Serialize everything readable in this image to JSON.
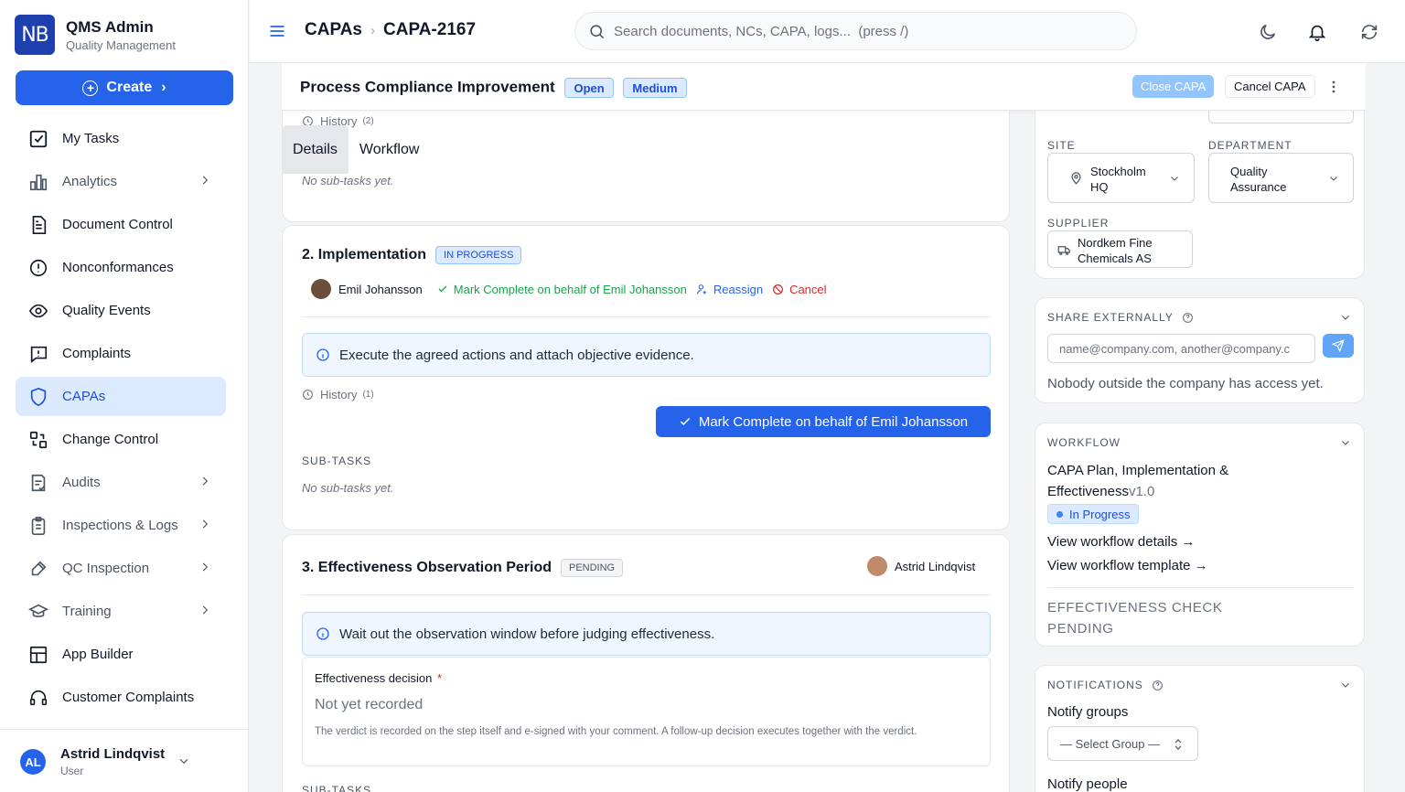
{
  "brand": {
    "logo": "NB",
    "title": "QMS Admin",
    "subtitle": "Quality Management"
  },
  "create_label": "Create",
  "nav": [
    {
      "label": "My Tasks",
      "icon": "checkbox-icon",
      "arrow": false,
      "muted": false
    },
    {
      "label": "Analytics",
      "icon": "analytics-icon",
      "arrow": true,
      "muted": true
    },
    {
      "label": "Document Control",
      "icon": "document-icon",
      "arrow": false,
      "muted": false
    },
    {
      "label": "Nonconformances",
      "icon": "alert-circle-icon",
      "arrow": false,
      "muted": false
    },
    {
      "label": "Quality Events",
      "icon": "eye-icon",
      "arrow": false,
      "muted": false
    },
    {
      "label": "Complaints",
      "icon": "message-alert-icon",
      "arrow": false,
      "muted": false
    },
    {
      "label": "CAPAs",
      "icon": "shield-icon",
      "arrow": false,
      "active": true
    },
    {
      "label": "Change Control",
      "icon": "change-control-icon",
      "arrow": false,
      "muted": false
    },
    {
      "label": "Audits",
      "icon": "audit-icon",
      "arrow": true,
      "muted": true
    },
    {
      "label": "Inspections & Logs",
      "icon": "clipboard-icon",
      "arrow": true,
      "muted": true
    },
    {
      "label": "QC Inspection",
      "icon": "tools-icon",
      "arrow": true,
      "muted": true
    },
    {
      "label": "Training",
      "icon": "graduation-cap-icon",
      "arrow": true,
      "muted": true
    },
    {
      "label": "App Builder",
      "icon": "grid-icon",
      "arrow": false,
      "muted": false
    },
    {
      "label": "Customer Complaints",
      "icon": "headset-icon",
      "arrow": false,
      "muted": false
    }
  ],
  "user": {
    "initials": "AL",
    "name": "Astrid Lindqvist",
    "role": "User"
  },
  "breadcrumb": {
    "parent": "CAPAs",
    "current": "CAPA-2167"
  },
  "search": {
    "placeholder": "Search documents, NCs, CAPA, logs...  (press /)"
  },
  "capa": {
    "title": "Process Compliance Improvement",
    "status": "Open",
    "priority": "Medium",
    "close_label": "Close CAPA",
    "cancel_label": "Cancel CAPA"
  },
  "tabs": [
    "Details",
    "Workflow"
  ],
  "history_top": {
    "label": "History",
    "count": "(2)"
  },
  "step1": {
    "no_subtasks": "No sub-tasks yet."
  },
  "step2": {
    "title": "2. Implementation",
    "status": "IN PROGRESS",
    "assignee": "Emil Johansson",
    "mark_link": "Mark Complete on behalf of Emil Johansson",
    "reassign": "Reassign",
    "cancel": "Cancel",
    "info": "Execute the agreed actions and attach objective evidence.",
    "history": {
      "label": "History",
      "count": "(1)"
    },
    "mark_button": "Mark Complete on behalf of Emil Johansson",
    "subtasks_label": "SUB-TASKS",
    "no_subtasks": "No sub-tasks yet."
  },
  "step3": {
    "title": "3. Effectiveness Observation Period",
    "status": "PENDING",
    "assignee": "Astrid Lindqvist",
    "info": "Wait out the observation window before judging effectiveness.",
    "decision_label": "Effectiveness decision",
    "required_mark": "*",
    "decision_value": "Not yet recorded",
    "decision_help": "The verdict is recorded on the step itself and e-signed with your comment. A follow-up decision executes together with the verdict.",
    "subtasks_label": "SUB-TASKS"
  },
  "details": {
    "site_label": "SITE",
    "site_value": "Stockholm HQ",
    "department_label": "DEPARTMENT",
    "department_value": "Quality Assurance",
    "supplier_label": "SUPPLIER",
    "supplier_value": "Nordkem Fine Chemicals AS"
  },
  "share": {
    "label": "SHARE EXTERNALLY",
    "placeholder": "name@company.com, another@company.c",
    "note": "Nobody outside the company has access yet."
  },
  "workflow": {
    "label": "WORKFLOW",
    "name": "CAPA Plan, Implementation & Effectiveness",
    "version": "v1.0",
    "status": "In Progress",
    "details_link": "View workflow details →",
    "template_link": "View workflow template →",
    "check_label": "EFFECTIVENESS CHECK",
    "check_status": "PENDING"
  },
  "notifications": {
    "label": "NOTIFICATIONS",
    "groups_label": "Notify groups",
    "group_select": "— Select Group —",
    "people_label": "Notify people"
  },
  "colors": {
    "primary": "#2563eb",
    "active_bg": "#dbeafe",
    "success": "#16a34a",
    "danger": "#dc2626"
  }
}
